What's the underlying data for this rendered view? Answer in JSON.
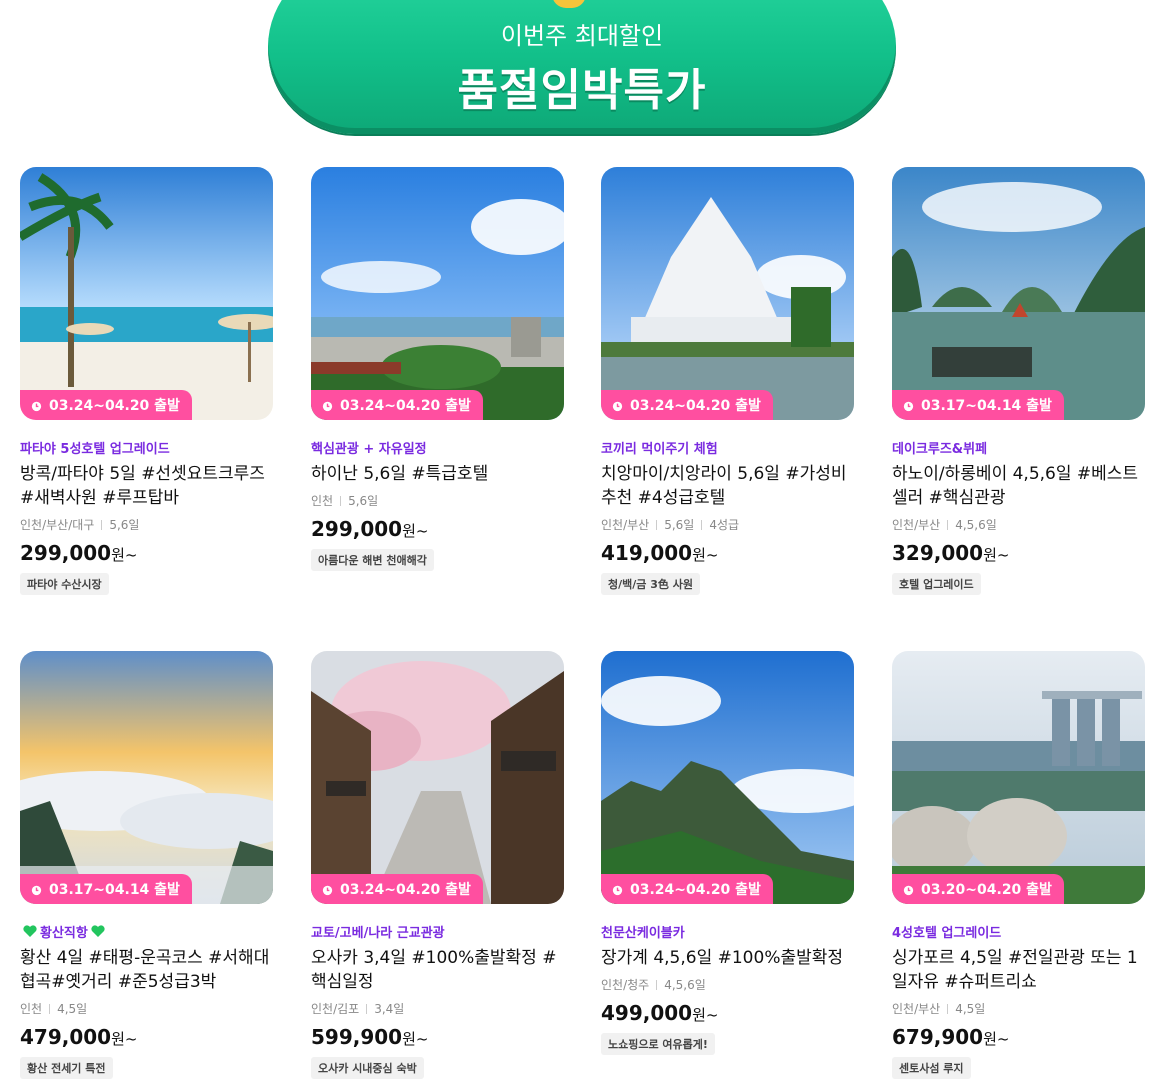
{
  "banner": {
    "subtitle": "이번주 최대할인",
    "title": "품절임박특가"
  },
  "colors": {
    "accent": "#13c48e",
    "badge": "#ff4fa0",
    "tag": "#7a2be0"
  },
  "products": [
    {
      "date": "03.24~04.20 출발",
      "tag": "파타야 5성호텔 업그레이드",
      "title": "방콕/파타야 5일 #선셋요트크루즈 #새벽사원 #루프탑바",
      "meta": [
        "인천/부산/대구",
        "5,6일"
      ],
      "price": "299,000",
      "won": "원~",
      "chip": "파타야 수산시장"
    },
    {
      "date": "03.24~04.20 출발",
      "tag": "핵심관광 + 자유일정",
      "title": "하이난 5,6일 #특급호텔",
      "meta": [
        "인천",
        "5,6일"
      ],
      "price": "299,000",
      "won": "원~",
      "chip": "아름다운 해변 천애해각"
    },
    {
      "date": "03.24~04.20 출발",
      "tag": "코끼리 먹이주기 체험",
      "title": "치앙마이/치앙라이 5,6일 #가성비추천 #4성급호텔",
      "meta": [
        "인천/부산",
        "5,6일",
        "4성급"
      ],
      "price": "419,000",
      "won": "원~",
      "chip": "청/백/금 3色 사원"
    },
    {
      "date": "03.17~04.14 출발",
      "tag": "데이크루즈&뷔페",
      "title": "하노이/하롱베이 4,5,6일 #베스트셀러 #핵심관광",
      "meta": [
        "인천/부산",
        "4,5,6일"
      ],
      "price": "329,000",
      "won": "원~",
      "chip": "호텔 업그레이드"
    },
    {
      "date": "03.17~04.14 출발",
      "tag": "황산직항",
      "title": "황산 4일 #태평-운곡코스 #서해대협곡#옛거리 #준5성급3박",
      "meta": [
        "인천",
        "4,5일"
      ],
      "price": "479,000",
      "won": "원~",
      "chip": "황산 전세기 특전"
    },
    {
      "date": "03.24~04.20 출발",
      "tag": "교토/고베/나라 근교관광",
      "title": "오사카 3,4일 #100%출발확정 #핵심일정",
      "meta": [
        "인천/김포",
        "3,4일"
      ],
      "price": "599,900",
      "won": "원~",
      "chip": "오사카 시내중심 숙박"
    },
    {
      "date": "03.24~04.20 출발",
      "tag": "천문산케이블카",
      "title": "장가계 4,5,6일 #100%출발확정",
      "meta": [
        "인천/청주",
        "4,5,6일"
      ],
      "price": "499,000",
      "won": "원~",
      "chip": "노쇼핑으로 여유롭게!"
    },
    {
      "date": "03.20~04.20 출발",
      "tag": "4성호텔 업그레이드",
      "title": "싱가포르 4,5일 #전일관광 또는 1일자유 #슈퍼트리쇼",
      "meta": [
        "인천/부산",
        "4,5일"
      ],
      "price": "679,900",
      "won": "원~",
      "chip": "센토사섬 루지"
    }
  ]
}
